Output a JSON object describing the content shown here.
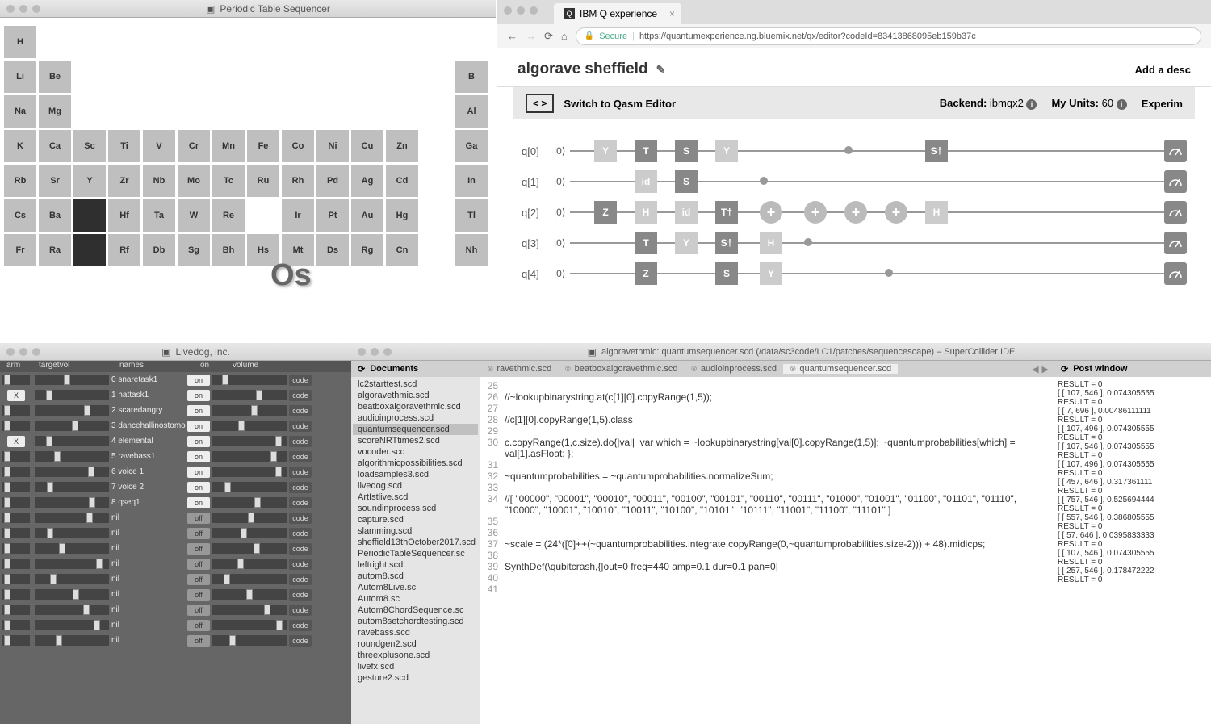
{
  "periodic": {
    "title": "Periodic Table Sequencer",
    "overlay": "Os",
    "rows": [
      [
        "H",
        "",
        "",
        "",
        "",
        "",
        "",
        "",
        "",
        "",
        "",
        "",
        "",
        ""
      ],
      [
        "Li",
        "Be",
        "",
        "",
        "",
        "",
        "",
        "",
        "",
        "",
        "",
        "",
        "",
        "B"
      ],
      [
        "Na",
        "Mg",
        "",
        "",
        "",
        "",
        "",
        "",
        "",
        "",
        "",
        "",
        "",
        "Al"
      ],
      [
        "K",
        "Ca",
        "Sc",
        "Ti",
        "V",
        "Cr",
        "Mn",
        "Fe",
        "Co",
        "Ni",
        "Cu",
        "Zn",
        "",
        "Ga"
      ],
      [
        "Rb",
        "Sr",
        "Y",
        "Zr",
        "Nb",
        "Mo",
        "Tc",
        "Ru",
        "Rh",
        "Pd",
        "Ag",
        "Cd",
        "",
        "In"
      ],
      [
        "Cs",
        "Ba",
        "*",
        "Hf",
        "Ta",
        "W",
        "Re",
        "",
        "Ir",
        "Pt",
        "Au",
        "Hg",
        "",
        "Tl"
      ],
      [
        "Fr",
        "Ra",
        "*",
        "Rf",
        "Db",
        "Sg",
        "Bh",
        "Hs",
        "Mt",
        "Ds",
        "Rg",
        "Cn",
        "",
        "Nh"
      ]
    ]
  },
  "browser": {
    "tab_title": "IBM Q experience",
    "secure_label": "Secure",
    "url": "https://quantumexperience.ng.bluemix.net/qx/editor?codeId=83413868095eb159b37c",
    "page_title": "algorave sheffield",
    "add_desc": "Add a desc",
    "switch_label": "Switch to Qasm Editor",
    "backend_label": "Backend:",
    "backend_value": "ibmqx2",
    "units_label": "My Units:",
    "units_value": "60",
    "experiment_label": "Experim",
    "qubits": [
      {
        "label": "q[0]",
        "ket": "|0⟩",
        "gates": [
          {
            "p": 30,
            "t": "Y",
            "c": "light"
          },
          {
            "p": 80,
            "t": "T",
            "c": "dark"
          },
          {
            "p": 130,
            "t": "S",
            "c": "dark"
          },
          {
            "p": 180,
            "t": "Y",
            "c": "light"
          },
          {
            "p": 440,
            "t": "S†",
            "c": "dark"
          }
        ],
        "dots": [
          {
            "p": 340
          }
        ],
        "meter": true
      },
      {
        "label": "q[1]",
        "ket": "|0⟩",
        "gates": [
          {
            "p": 80,
            "t": "id",
            "c": "light"
          },
          {
            "p": 130,
            "t": "S",
            "c": "dark"
          }
        ],
        "dots": [
          {
            "p": 235
          }
        ],
        "meter": true
      },
      {
        "label": "q[2]",
        "ket": "|0⟩",
        "gates": [
          {
            "p": 30,
            "t": "Z",
            "c": "dark"
          },
          {
            "p": 80,
            "t": "H",
            "c": "light"
          },
          {
            "p": 130,
            "t": "id",
            "c": "light"
          },
          {
            "p": 180,
            "t": "T†",
            "c": "dark"
          },
          {
            "p": 235,
            "t": "+",
            "c": "plus"
          },
          {
            "p": 290,
            "t": "+",
            "c": "plus"
          },
          {
            "p": 340,
            "t": "+",
            "c": "plus"
          },
          {
            "p": 390,
            "t": "+",
            "c": "plus"
          },
          {
            "p": 440,
            "t": "H",
            "c": "light"
          }
        ],
        "dots": [],
        "meter": true
      },
      {
        "label": "q[3]",
        "ket": "|0⟩",
        "gates": [
          {
            "p": 80,
            "t": "T",
            "c": "dark"
          },
          {
            "p": 130,
            "t": "Y",
            "c": "light"
          },
          {
            "p": 180,
            "t": "S†",
            "c": "dark"
          },
          {
            "p": 235,
            "t": "H",
            "c": "light"
          }
        ],
        "dots": [
          {
            "p": 290
          }
        ],
        "meter": true
      },
      {
        "label": "q[4]",
        "ket": "|0⟩",
        "gates": [
          {
            "p": 80,
            "t": "Z",
            "c": "dark"
          },
          {
            "p": 180,
            "t": "S",
            "c": "dark"
          },
          {
            "p": 235,
            "t": "Y",
            "c": "light"
          }
        ],
        "dots": [
          {
            "p": 390
          }
        ],
        "meter": true
      }
    ]
  },
  "livedog": {
    "title": "Livedog, inc.",
    "headers": [
      "arm",
      "targetvol",
      "names",
      "on",
      "volume",
      ""
    ],
    "rows": [
      {
        "num": "0",
        "name": "snaretask1",
        "x": false,
        "on": true
      },
      {
        "num": "1",
        "name": "hattask1",
        "x": true,
        "on": true
      },
      {
        "num": "2",
        "name": "scaredangry",
        "x": false,
        "on": true
      },
      {
        "num": "3",
        "name": "dancehallinostomo",
        "x": false,
        "on": true
      },
      {
        "num": "4",
        "name": "elemental",
        "x": true,
        "on": true
      },
      {
        "num": "5",
        "name": "ravebass1",
        "x": false,
        "on": true
      },
      {
        "num": "6",
        "name": "voice 1",
        "x": false,
        "on": true
      },
      {
        "num": "7",
        "name": "voice 2",
        "x": false,
        "on": true
      },
      {
        "num": "8",
        "name": "qseq1",
        "x": false,
        "on": true
      },
      {
        "num": "",
        "name": "nil",
        "x": false,
        "on": false
      },
      {
        "num": "",
        "name": "nil",
        "x": false,
        "on": false
      },
      {
        "num": "",
        "name": "nil",
        "x": false,
        "on": false
      },
      {
        "num": "",
        "name": "nil",
        "x": false,
        "on": false
      },
      {
        "num": "",
        "name": "nil",
        "x": false,
        "on": false
      },
      {
        "num": "",
        "name": "nil",
        "x": false,
        "on": false
      },
      {
        "num": "",
        "name": "nil",
        "x": false,
        "on": false
      },
      {
        "num": "",
        "name": "nil",
        "x": false,
        "on": false
      },
      {
        "num": "",
        "name": "nil",
        "x": false,
        "on": false
      }
    ],
    "on_label": "on",
    "off_label": "off",
    "code_label": "code",
    "x_label": "X"
  },
  "supercollider": {
    "title": "algoravethmic: quantumsequencer.scd (/data/sc3code/LC1/patches/sequencescape) – SuperCollider IDE",
    "docs_header": "Documents",
    "post_header": "Post window",
    "docs": [
      "lc2starttest.scd",
      "algoravethmic.scd",
      "beatboxalgoravethmic.scd",
      "audioinprocess.scd",
      "quantumsequencer.scd",
      "scoreNRTtimes2.scd",
      "vocoder.scd",
      "algorithmicpossibilities.scd",
      "loadsamples3.scd",
      "livedog.scd",
      "ArtIstlive.scd",
      "soundinprocess.scd",
      "capture.scd",
      "slamming.scd",
      "sheffield13thOctober2017.scd",
      "PeriodicTableSequencer.sc",
      "leftright.scd",
      "autom8.scd",
      "Autom8Live.sc",
      "Autom8.sc",
      "Autom8ChordSequence.sc",
      "autom8setchordtesting.scd",
      "ravebass.scd",
      "roundgen2.scd",
      "threexplusone.scd",
      "livefx.scd",
      "gesture2.scd"
    ],
    "docs_selected": "quantumsequencer.scd",
    "tabs": [
      "ravethmic.scd",
      "beatboxalgoravethmic.scd",
      "audioinprocess.scd",
      "quantumsequencer.scd"
    ],
    "tab_active": "quantumsequencer.scd",
    "code": [
      {
        "n": 25,
        "t": ""
      },
      {
        "n": 26,
        "t": "//~lookupbinarystring.at(c[1][0].copyRange(1,5));"
      },
      {
        "n": 27,
        "t": ""
      },
      {
        "n": 28,
        "t": "//c[1][0].copyRange(1,5).class"
      },
      {
        "n": 29,
        "t": ""
      },
      {
        "n": 30,
        "t": "c.copyRange(1,c.size).do{|val|  var which = ~lookupbinarystring[val[0].copyRange(1,5)]; ~quantumprobabilities[which] = val[1].asFloat; };"
      },
      {
        "n": 31,
        "t": ""
      },
      {
        "n": 32,
        "t": "~quantumprobabilities = ~quantumprobabilities.normalizeSum;"
      },
      {
        "n": 33,
        "t": ""
      },
      {
        "n": 34,
        "t": "//[ \"00000\", \"00001\", \"00010\", \"00011\", \"00100\", \"00101\", \"00110\", \"00111\", \"01000\", \"01001\", \"01100\", \"01101\", \"01110\", \"10000\", \"10001\", \"10010\", \"10011\", \"10100\", \"10101\", \"10111\", \"11001\", \"11100\", \"11101\" ]"
      },
      {
        "n": 35,
        "t": ""
      },
      {
        "n": 36,
        "t": ""
      },
      {
        "n": 37,
        "t": "~scale = (24*([0]++(~quantumprobabilities.integrate.copyRange(0,~quantumprobabilities.size-2))) + 48).midicps;"
      },
      {
        "n": 38,
        "t": ""
      },
      {
        "n": 39,
        "t": "SynthDef(\\qubitcrash,{|out=0 freq=440 amp=0.1 dur=0.1 pan=0|"
      },
      {
        "n": 40,
        "t": ""
      },
      {
        "n": 41,
        "t": ""
      }
    ],
    "post": [
      "RESULT = 0",
      "[ [ 107, 546 ], 0.074305555",
      "RESULT = 0",
      "[ [ 7, 696 ], 0.00486111111",
      "RESULT = 0",
      "[ [ 107, 496 ], 0.074305555",
      "RESULT = 0",
      "[ [ 107, 546 ], 0.074305555",
      "RESULT = 0",
      "[ [ 107, 496 ], 0.074305555",
      "RESULT = 0",
      "[ [ 457, 646 ], 0.317361111",
      "RESULT = 0",
      "[ [ 757, 546 ], 0.525694444",
      "RESULT = 0",
      "[ [ 557, 546 ], 0.386805555",
      "RESULT = 0",
      "[ [ 57, 646 ], 0.0395833333",
      "RESULT = 0",
      "[ [ 107, 546 ], 0.074305555",
      "RESULT = 0",
      "[ [ 257, 546 ], 0.178472222",
      "RESULT = 0"
    ]
  }
}
